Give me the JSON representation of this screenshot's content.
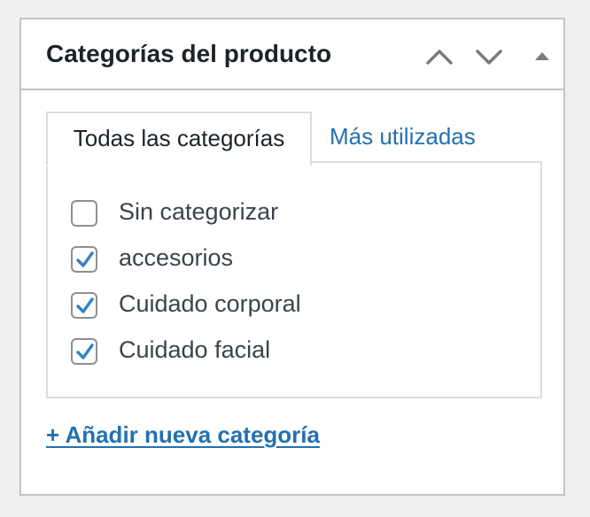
{
  "panel": {
    "title": "Categorías del producto",
    "controls": {
      "move_up_icon": "chevron-up-icon",
      "move_down_icon": "chevron-down-icon",
      "toggle_icon": "triangle-up-icon"
    }
  },
  "tabs": [
    {
      "label": "Todas las categorías",
      "active": true
    },
    {
      "label": "Más utilizadas",
      "active": false
    }
  ],
  "categories": [
    {
      "label": "Sin categorizar",
      "checked": false
    },
    {
      "label": "accesorios",
      "checked": true
    },
    {
      "label": "Cuidado corporal",
      "checked": true
    },
    {
      "label": "Cuidado facial",
      "checked": true
    }
  ],
  "add_link": "+ Añadir nueva categoría",
  "colors": {
    "background": "#f0f0f1",
    "border": "#c3c4c7",
    "link": "#2271b1",
    "checkmark": "#3582c4",
    "text": "#1d2327"
  }
}
